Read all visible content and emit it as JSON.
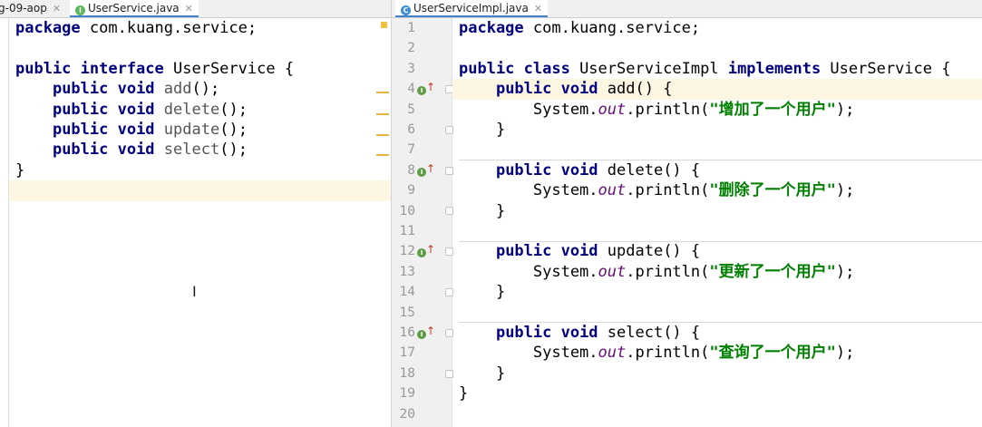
{
  "left_editor": {
    "tabs": [
      {
        "label": "g-09-aop",
        "icon": "maven-module-icon"
      },
      {
        "label": "UserService.java",
        "icon": "interface-icon",
        "icon_glyph": "I"
      }
    ],
    "lines": [
      "package com.kuang.service;",
      "",
      "public interface UserService {",
      "    public void add();",
      "    public void delete();",
      "    public void update();",
      "    public void select();",
      "}",
      ""
    ]
  },
  "right_editor": {
    "tab": {
      "label": "UserServiceImpl.java",
      "icon": "class-icon",
      "icon_glyph": "C"
    },
    "line_numbers": [
      "1",
      "2",
      "3",
      "4",
      "5",
      "6",
      "7",
      "8",
      "9",
      "10",
      "11",
      "12",
      "13",
      "14",
      "15",
      "16",
      "17",
      "18",
      "19",
      "20"
    ],
    "lines": [
      "package com.kuang.service;",
      "",
      "public class UserServiceImpl implements UserService {",
      "    public void add() {",
      "        System.out.println(\"增加了一个用户\");",
      "    }",
      "",
      "    public void delete() {",
      "        System.out.println(\"删除了一个用户\");",
      "    }",
      "",
      "    public void update() {",
      "        System.out.println(\"更新了一个用户\");",
      "    }",
      "",
      "    public void select() {",
      "        System.out.println(\"查询了一个用户\");",
      "    }",
      "}",
      ""
    ]
  },
  "colors": {
    "keyword": "#000080",
    "string": "#008000",
    "field": "#660e7a",
    "current_line": "#fdf6e3",
    "impl_icon": "#5f9c45"
  }
}
